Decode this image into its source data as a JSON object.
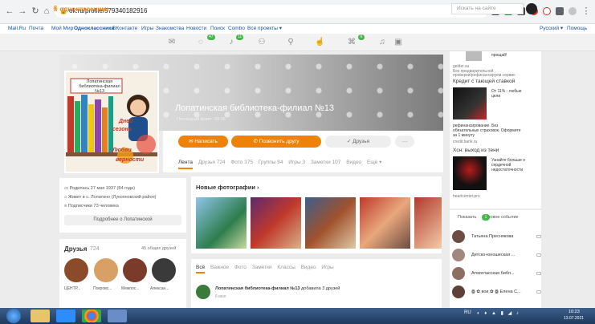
{
  "browser": {
    "url": "ok.ru/profile/579340182916",
    "back_icon": "arrow-left-icon",
    "forward_icon": "arrow-right-icon",
    "reload_icon": "reload-icon",
    "lock_icon": "lock-icon"
  },
  "bookmarks": {
    "items": [
      "Mail.Ru",
      "Почта",
      "Мой Мир",
      "Одноклассники",
      "ВКонтакте",
      "Игры",
      "Знакомства",
      "Новости",
      "Поиск",
      "Combo",
      "Все проекты ▾"
    ],
    "right_items": [
      "Русский ▾",
      "Помощь"
    ]
  },
  "ok_header": {
    "logo": "одноклассники",
    "search_placeholder": "Искать на сайте",
    "badges": [
      "47",
      "11",
      "6"
    ]
  },
  "profile": {
    "name": "Лопатинская библиотека-филиал №13",
    "last_visit": "Последний визит: 09:26",
    "photo_caption_lines": [
      "Лопатинская",
      "библиотека-филиал",
      "№13"
    ],
    "photo_slogan_lines": [
      "Дней",
      "сезона",
      "Любви",
      "верности"
    ],
    "buttons": {
      "write": "Написать",
      "call": "Позвонить другу",
      "friends": "Друзья",
      "more": "···"
    },
    "tabs": [
      "Лента",
      "Друзья 724",
      "Фото 375",
      "Группы 84",
      "Игры 3",
      "Заметки 107",
      "Видео",
      "Ещё ▾"
    ]
  },
  "about": {
    "born": "Родилась 27 мая 1937 (84 года)",
    "lives": "Живет в с. Лопатино (Лукояновский район)",
    "followers": "Подписчики 73 человека",
    "more_button": "Подробнее о Лопатинской"
  },
  "friends": {
    "title": "Друзья",
    "count": "724",
    "mutual": "45 общих друзей",
    "items": [
      "ЦЕНТР...",
      "Покровс...",
      "Межпос...",
      "Алексан..."
    ]
  },
  "photos": {
    "title": "Новые фотографии",
    "arrow": "›"
  },
  "feed": {
    "tabs": [
      "Всё",
      "Важное",
      "Фото",
      "Заметки",
      "Классы",
      "Видео",
      "Игры"
    ],
    "post_author": "Лопатинская библиотека-филиал №13",
    "post_action": " добавила 3 друзей",
    "post_time": "6 июл"
  },
  "ads": {
    "ad1_lines": [
      "прощай!",
      "gelder.su",
      "Без предварительной",
      "проверки/рефинансируем.сервис"
    ],
    "ad2_title": "Кредит с тающей ставкой",
    "ad2_text": [
      "От 11% - любые",
      "цели"
    ],
    "ad2_lines": [
      "рефинансирование. Без",
      "обязательных страховок. Оформите",
      "за 1 минуту",
      "credit.bank.ru"
    ],
    "ad3_title": "Хсн: выход из тени",
    "ad3_text": [
      "Узнайте больше о",
      "сердечной",
      "недостаточности"
    ],
    "ad3_source": "heartcenter.pro"
  },
  "events": {
    "show": "Показать",
    "count": "1",
    "label": "новое событие",
    "items": [
      "Татьяна Преснякова",
      "Детско-юношеская ...",
      "Атмогласская библ...",
      "ꙮ ✿ вои ✿ ꙮ Елена С..."
    ]
  },
  "taskbar": {
    "lang": "RU",
    "time": "10:23",
    "date": "13.07.2021"
  },
  "colors": {
    "accent": "#ee8208",
    "badge": "#45b649",
    "taskbar": "#2a4a72"
  }
}
